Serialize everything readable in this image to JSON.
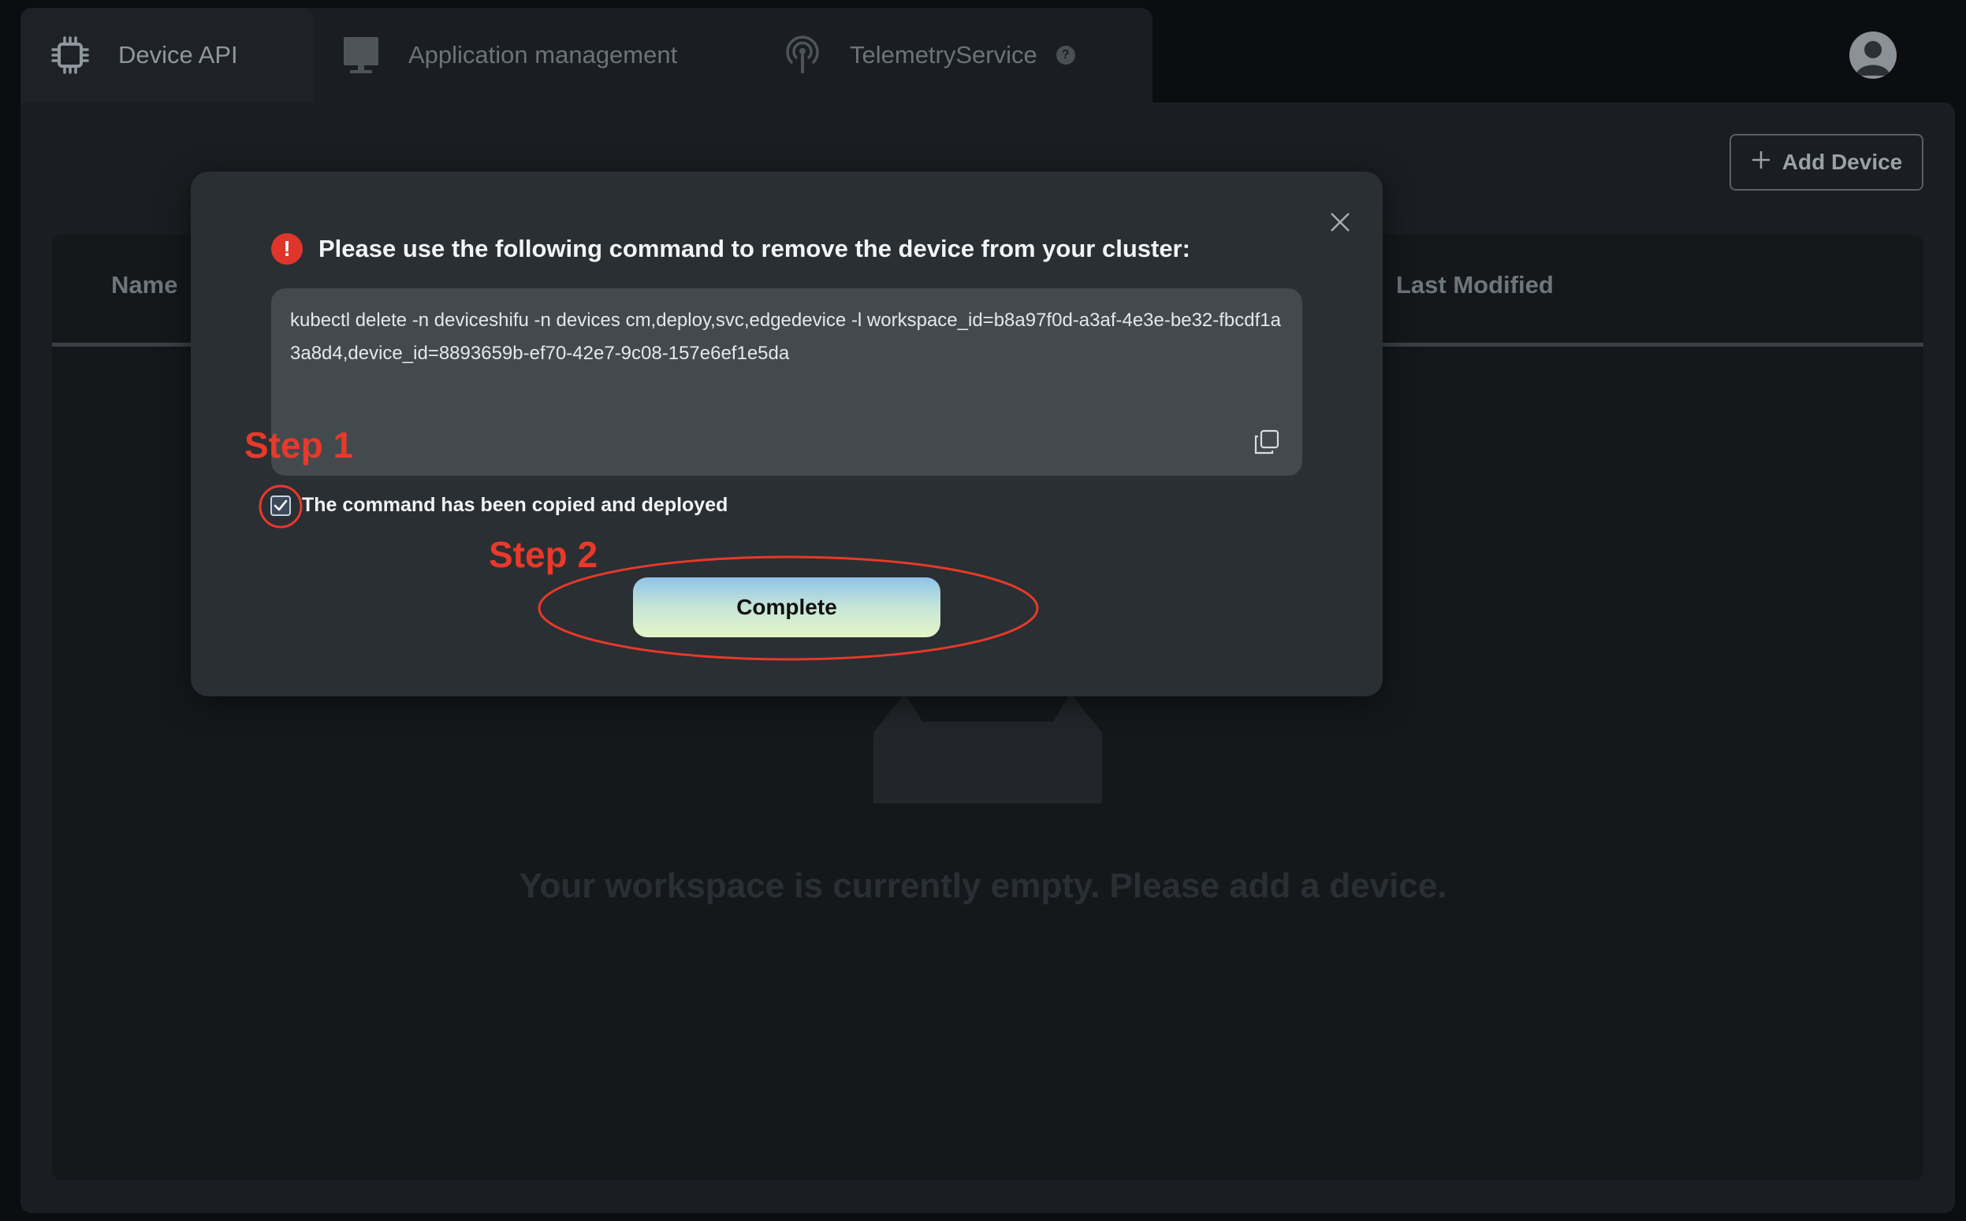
{
  "tabs": [
    {
      "label": "Device API",
      "icon": "chip-icon",
      "active": true
    },
    {
      "label": "Application management",
      "icon": "monitor-icon",
      "active": false
    },
    {
      "label": "TelemetryService",
      "icon": "antenna-icon",
      "active": false,
      "help_badge": "?"
    }
  ],
  "header": {
    "add_device_label": "Add Device",
    "add_icon": "plus-icon",
    "avatar_icon": "user-avatar-icon"
  },
  "table": {
    "columns": [
      "Name",
      "Last Modified"
    ]
  },
  "empty_state": {
    "message": "Your workspace is currently empty. Please add a device.",
    "icon": "empty-box-icon"
  },
  "modal": {
    "title": "Please use the following command to remove the device from your cluster:",
    "alert_icon": "exclamation-icon",
    "alert_glyph": "!",
    "command": "kubectl delete -n deviceshifu -n devices cm,deploy,svc,edgedevice -l workspace_id=b8a97f0d-a3af-4e3e-be32-fbcdf1a3a8d4,device_id=8893659b-ef70-42e7-9c08-157e6ef1e5da",
    "copy_icon": "copy-icon",
    "close_icon": "close-icon",
    "checkbox_label": "The command has been copied and deployed",
    "checkbox_checked": true,
    "complete_label": "Complete"
  },
  "annotations": {
    "step1": "Step 1",
    "step2": "Step 2",
    "color": "#e8392a"
  },
  "colors": {
    "background": "#0b0d10",
    "panel": "#1a1d21",
    "modal": "#2a2f33",
    "command_box": "#424a4e",
    "alert": "#e0352b"
  }
}
